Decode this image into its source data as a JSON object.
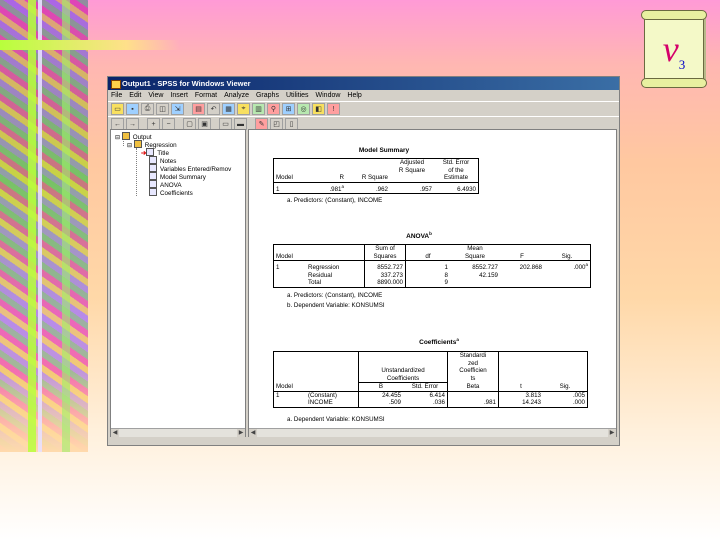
{
  "badge": {
    "letter": "v",
    "subscript": "3"
  },
  "window": {
    "title": "Output1 - SPSS for Windows Viewer",
    "menu": [
      "File",
      "Edit",
      "View",
      "Insert",
      "Format",
      "Analyze",
      "Graphs",
      "Utilities",
      "Window",
      "Help"
    ]
  },
  "tree": {
    "output": "Output",
    "regression": "Regression",
    "items": [
      "Title",
      "Notes",
      "Variables Entered/Remov",
      "Model Summary",
      "ANOVA",
      "Coefficients"
    ]
  },
  "model_summary": {
    "title": "Model Summary",
    "headers": [
      "Model",
      "R",
      "R Square",
      "Adjusted R Square",
      "Std. Error of the Estimate"
    ],
    "hdr_adj": [
      "Adjusted",
      "R Square"
    ],
    "hdr_se": [
      "Std. Error",
      "of the",
      "Estimate"
    ],
    "row": [
      "1",
      ".981",
      "a",
      ".962",
      ".957",
      "6.4930"
    ],
    "footnote": "a. Predictors: (Constant), INCOME"
  },
  "anova": {
    "title": "ANOVA",
    "title_sup": "b",
    "hdr_ss": [
      "Sum of",
      "Squares"
    ],
    "hdr_ms": [
      "Mean",
      "Square"
    ],
    "hdr": {
      "model": "Model",
      "df": "df",
      "f": "F",
      "sig": "Sig."
    },
    "rows": [
      {
        "model": "1",
        "name": "Regression",
        "ss": "8552.727",
        "df": "1",
        "ms": "8552.727",
        "f": "202.868",
        "sig": ".000",
        "sig_sup": "a"
      },
      {
        "model": "",
        "name": "Residual",
        "ss": "337.273",
        "df": "8",
        "ms": "42.159",
        "f": "",
        "sig": "",
        "sig_sup": ""
      },
      {
        "model": "",
        "name": "Total",
        "ss": "8890.000",
        "df": "9",
        "ms": "",
        "f": "",
        "sig": "",
        "sig_sup": ""
      }
    ],
    "footnote_a": "a. Predictors: (Constant), INCOME",
    "footnote_b": "b. Dependent Variable: KONSUMSI"
  },
  "coefficients": {
    "title": "Coefficients",
    "title_sup": "a",
    "hdr_std": [
      "Standardi",
      "zed",
      "Coefficien",
      "ts"
    ],
    "hdr_unstd": [
      "Unstandardized",
      "Coefficients"
    ],
    "hdr": {
      "model": "Model",
      "b": "B",
      "se": "Std. Error",
      "beta": "Beta",
      "t": "t",
      "sig": "Sig."
    },
    "rows": [
      {
        "model": "1",
        "name": "(Constant)",
        "b": "24.455",
        "se": "6.414",
        "beta": "",
        "t": "3.813",
        "sig": ".005"
      },
      {
        "model": "",
        "name": "INCOME",
        "b": ".509",
        "se": ".036",
        "beta": ".981",
        "t": "14.243",
        "sig": ".000"
      }
    ],
    "footnote": "a. Dependent Variable: KONSUMSI"
  }
}
